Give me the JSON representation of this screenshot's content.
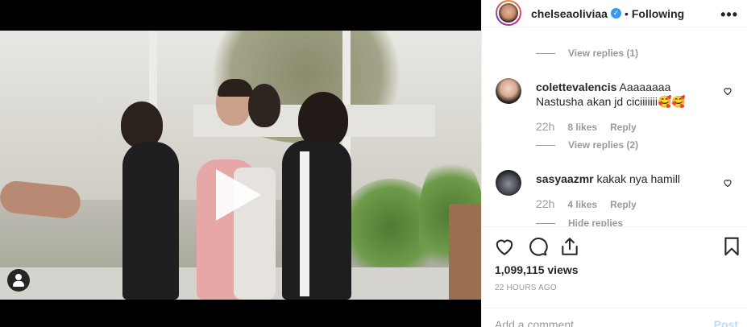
{
  "post": {
    "username": "chelseaoliviaa",
    "verified_mark": "✓",
    "separator": "•",
    "follow_status": "Following",
    "more_label": "•••"
  },
  "comments": {
    "top_view_replies": "View replies (1)",
    "items": [
      {
        "username": "colettevalencis",
        "text": "Aaaaaaaa Nastusha akan jd ciciiiiiii🥰🥰",
        "time": "22h",
        "likes": "8 likes",
        "reply_label": "Reply",
        "view_replies": "View replies (2)"
      },
      {
        "username": "sasyaazmr",
        "text": "kakak nya hamill",
        "time": "22h",
        "likes": "4 likes",
        "reply_label": "Reply",
        "view_replies": "Hide replies"
      }
    ]
  },
  "stats": {
    "views": "1,099,115 views",
    "posted": "22 HOURS AGO"
  },
  "add_comment": {
    "placeholder": "Add a comment…",
    "post_label": "Post"
  },
  "icons": {
    "like": "heart-icon",
    "comment": "comment-icon",
    "share": "share-icon",
    "save": "bookmark-icon",
    "play": "play-icon",
    "tags": "user-tag-icon"
  },
  "colors": {
    "accent": "#3897f0",
    "text": "#262626",
    "muted": "#999999",
    "post_disabled": "#b2dffc"
  }
}
